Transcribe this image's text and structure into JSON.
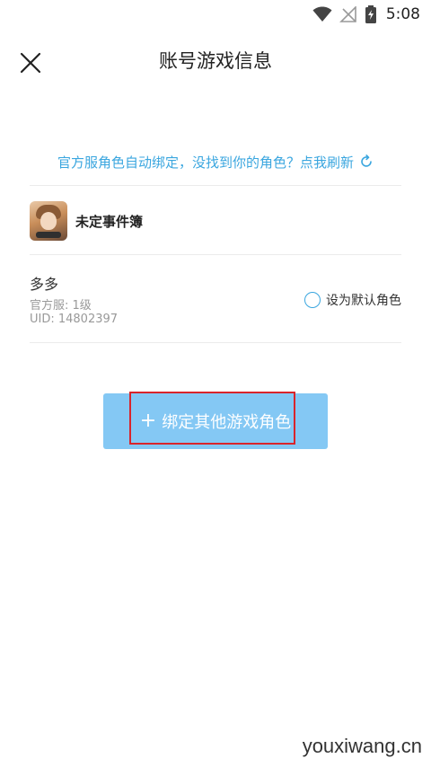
{
  "status_bar": {
    "time": "5:08",
    "icons": [
      "wifi-icon",
      "no-signal-icon",
      "battery-charging-icon"
    ]
  },
  "header": {
    "title": "账号游戏信息",
    "close_icon": "close-icon"
  },
  "refresh_prompt": {
    "text": "官方服角色自动绑定，没找到你的角色？点我刷新",
    "icon": "refresh-icon"
  },
  "game": {
    "name": "未定事件簿"
  },
  "role": {
    "name": "多多",
    "server": "官方服: 1级",
    "uid": "UID: 14802397",
    "default_label": "设为默认角色"
  },
  "bind_button": {
    "plus": "+",
    "label": "绑定其他游戏角色"
  },
  "watermark": "youxiwang.cn",
  "colors": {
    "accent": "#3aa6df",
    "button": "#84c8f4",
    "highlight": "#d9242b"
  }
}
